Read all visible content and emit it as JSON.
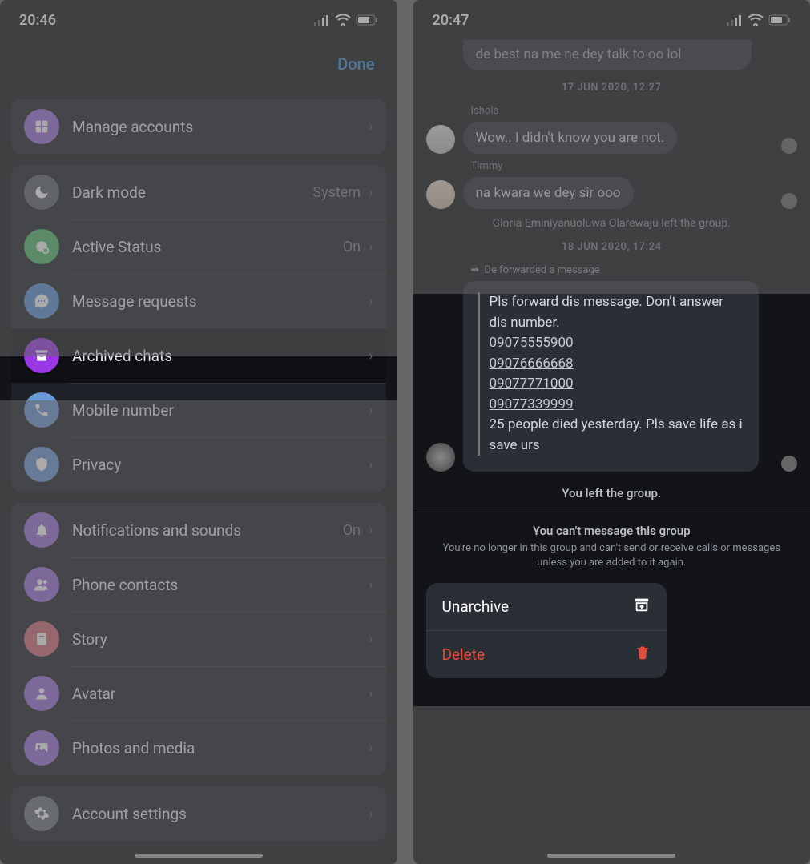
{
  "left": {
    "status": {
      "time": "20:46"
    },
    "header": {
      "done": "Done"
    },
    "sections": [
      {
        "rows": [
          {
            "icon": "accounts",
            "label": "Manage accounts",
            "value": "",
            "color": "#9a6fd9"
          }
        ]
      },
      {
        "rows": [
          {
            "icon": "moon",
            "label": "Dark mode",
            "value": "System",
            "color": "#5b6470"
          },
          {
            "icon": "status",
            "label": "Active Status",
            "value": "On",
            "color": "#4fb86b"
          },
          {
            "icon": "message",
            "label": "Message requests",
            "value": "",
            "color": "#5b8fd6"
          },
          {
            "icon": "archive",
            "label": "Archived chats",
            "value": "",
            "color": "#9b36e6",
            "highlight": true
          },
          {
            "icon": "phone",
            "label": "Mobile number",
            "value": "",
            "color": "#6a98d6"
          },
          {
            "icon": "shield",
            "label": "Privacy",
            "value": "",
            "color": "#6a98d6"
          }
        ]
      },
      {
        "rows": [
          {
            "icon": "bell",
            "label": "Notifications and sounds",
            "value": "On",
            "color": "#9a6fd9"
          },
          {
            "icon": "contacts",
            "label": "Phone contacts",
            "value": "",
            "color": "#9a6fd9"
          },
          {
            "icon": "story",
            "label": "Story",
            "value": "",
            "color": "#d66a7f"
          },
          {
            "icon": "avatar",
            "label": "Avatar",
            "value": "",
            "color": "#9a6fd9"
          },
          {
            "icon": "photo",
            "label": "Photos and media",
            "value": "",
            "color": "#9a6fd9"
          }
        ]
      },
      {
        "rows": [
          {
            "icon": "gear",
            "label": "Account settings",
            "value": "",
            "color": "#6e757e"
          }
        ]
      }
    ]
  },
  "right": {
    "status": {
      "time": "20:47"
    },
    "chat": {
      "truncated_top": "de best na me ne dey talk to oo lol",
      "ts1": "17 JUN 2020, 12:27",
      "m1_sender": "Ishola",
      "m1_text": "Wow.. I didn't know you are not.",
      "m2_sender": "Timmy",
      "m2_text": "na kwara we dey sir ooo",
      "sys1": "Gloria Eminiyanuoluwa Olarewaju left the group.",
      "ts2": "18 JUN 2020, 17:24",
      "fwd_note": "De forwarded a message",
      "fwd_body": "Pls forward dis message. Don't answer dis number.",
      "fwd_n1": "09075555900",
      "fwd_n2": "09076666668",
      "fwd_n3": "09077771000",
      "fwd_n4": "09077339999",
      "fwd_tail": "25 people died yesterday. Pls save life as i save urs",
      "sys2": "You left the group.",
      "blocked_title": "You can't message this group",
      "blocked_body": "You're no longer in this group and can't send or receive calls or messages unless you are added to it again."
    },
    "actions": {
      "unarchive": "Unarchive",
      "delete": "Delete"
    }
  }
}
